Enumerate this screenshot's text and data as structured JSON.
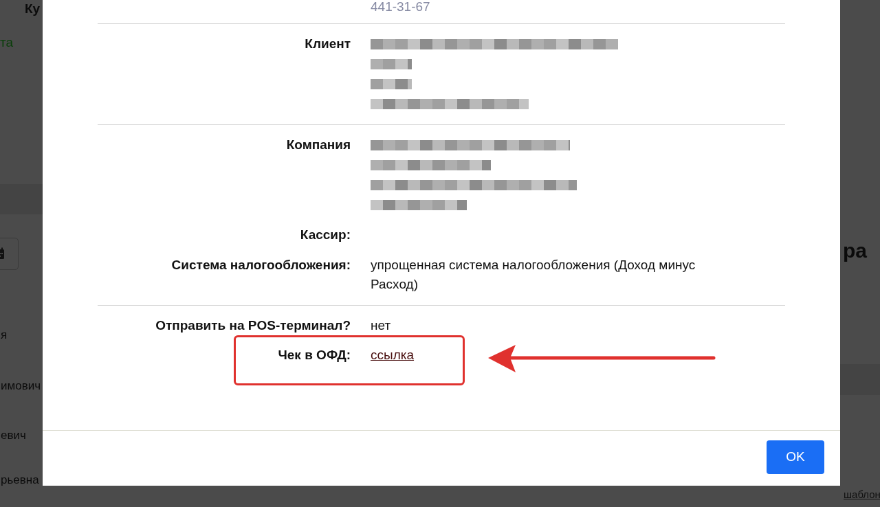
{
  "background": {
    "header_fragment": "Ку",
    "status_fragment": "та",
    "names": [
      "я",
      "имович",
      "евич",
      "рьевна"
    ],
    "heading_fragment": "ра",
    "link_fragment": "шаблон"
  },
  "modal": {
    "sections": [
      {
        "fields": [
          {
            "kind": "muted",
            "value": "441-31-67"
          }
        ]
      },
      {
        "fields": [
          {
            "kind": "redacted",
            "label": "Клиент"
          }
        ]
      },
      {
        "fields": [
          {
            "kind": "redacted",
            "label": "Компания"
          },
          {
            "kind": "empty",
            "label": "Кассир:"
          },
          {
            "kind": "text",
            "label": "Система налогообложения:",
            "value": "упрощенная система налогообложения (Доход минус Расход)"
          }
        ]
      },
      {
        "fields": [
          {
            "kind": "text",
            "label": "Отправить на POS-терминал?",
            "value": "нет"
          },
          {
            "kind": "link",
            "label": "Чек в ОФД:",
            "value": "ссылка",
            "highlighted": true
          }
        ]
      }
    ],
    "ok_button": "OK"
  }
}
